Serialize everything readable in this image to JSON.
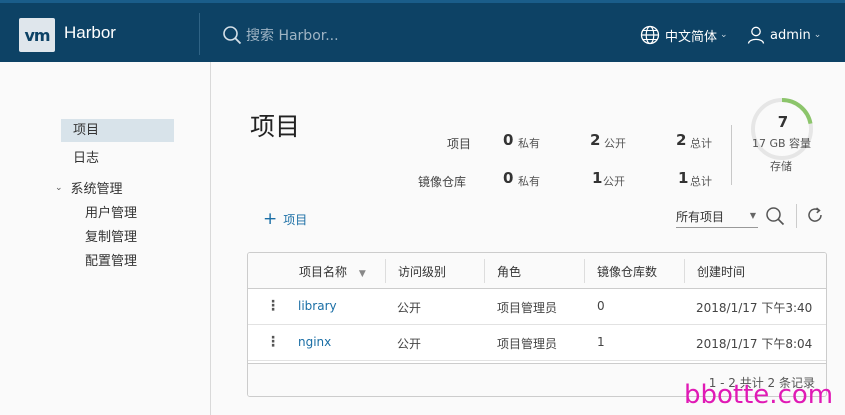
{
  "header": {
    "logo_text": "vm",
    "title": "Harbor",
    "search_placeholder": "搜索 Harbor...",
    "language": "中文简体",
    "user": "admin",
    "colors": {
      "bar": "#0d4265",
      "accent": "#1a6ea5"
    }
  },
  "sidebar": {
    "items": [
      {
        "label": "项目",
        "active": true
      },
      {
        "label": "日志",
        "active": false
      }
    ],
    "group": {
      "label": "系统管理",
      "children": [
        "用户管理",
        "复制管理",
        "配置管理"
      ]
    }
  },
  "main": {
    "title": "项目",
    "stats": {
      "projects_label": "项目",
      "repos_label": "镜像仓库",
      "projects": {
        "private": "0",
        "public": "2",
        "total": "2"
      },
      "repos": {
        "private": "0",
        "public": "1",
        "total": "1"
      },
      "units": {
        "private": "私有",
        "public": "公开",
        "total": "总计"
      }
    },
    "storage": {
      "count": "7",
      "capacity": "17 GB 容量",
      "label": "存储",
      "fill_fraction": 0.22
    },
    "add_button": "项目",
    "filter": "所有项目",
    "table": {
      "columns": [
        "项目名称",
        "访问级别",
        "角色",
        "镜像仓库数",
        "创建时间"
      ],
      "rows": [
        {
          "name": "library",
          "access": "公开",
          "role": "项目管理员",
          "repos": "0",
          "created": "2018/1/17 下午3:40"
        },
        {
          "name": "nginx",
          "access": "公开",
          "role": "项目管理员",
          "repos": "1",
          "created": "2018/1/17 下午8:04"
        }
      ],
      "footer": "1 - 2 共计 2 条记录"
    }
  },
  "watermark": "bbotte.com"
}
